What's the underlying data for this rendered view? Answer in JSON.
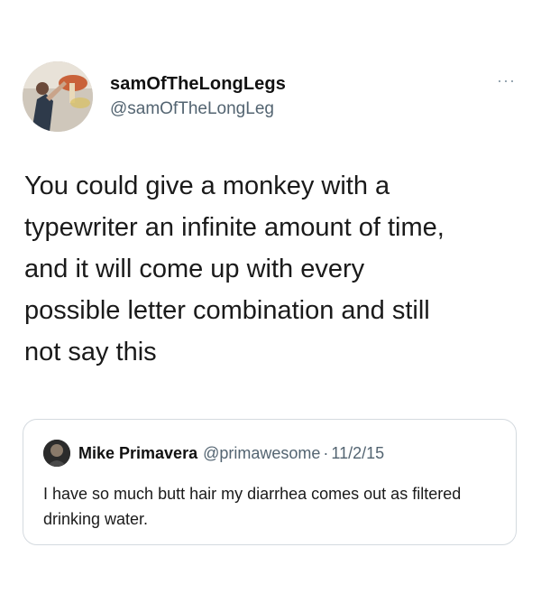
{
  "tweet": {
    "display_name": "samOfTheLongLegs",
    "handle": "@samOfTheLongLeg",
    "more_icon": "more-dots-icon",
    "text": "You could give a monkey with a\ntypewriter an infinite amount of time,\nand it will come up with every\npossible letter combination and still\nnot say this"
  },
  "quote": {
    "display_name": "Mike Primavera",
    "handle": "@primawesome",
    "separator": "·",
    "date": "11/2/15",
    "text": "I have so much butt hair my diarrhea comes out as filtered drinking water."
  },
  "colors": {
    "background": "#ffffff",
    "text": "#14171a",
    "secondary": "#536471",
    "border": "#d4dadf"
  }
}
